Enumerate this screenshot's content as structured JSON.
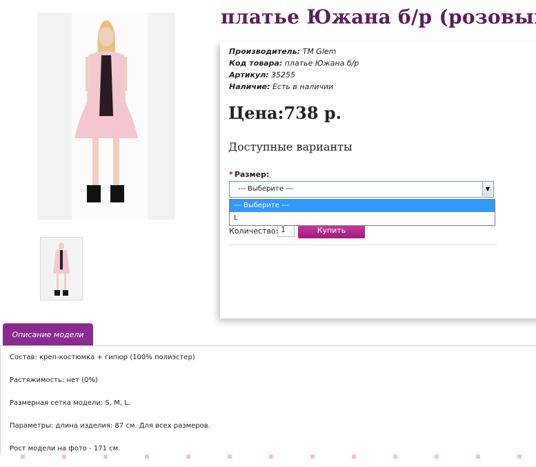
{
  "product": {
    "title": "платье Южана б/р (розовый)",
    "meta": [
      {
        "label": "Производитель:",
        "value": "TM Glem"
      },
      {
        "label": "Код товара:",
        "value": "платье Южана б/р"
      },
      {
        "label": "Артикул:",
        "value": "35255"
      },
      {
        "label": "Наличие:",
        "value": "Есть в наличии"
      }
    ],
    "price": "Цена:738 р.",
    "variants_heading": "Доступные варианты",
    "size_label": "Размер:",
    "size_required_mark": "*",
    "size_select_value": "--- Выберите ---",
    "size_options": [
      "--- Выберите ---",
      "L"
    ],
    "quantity_label": "Количество:",
    "quantity_value": "1",
    "buy_label": "Купить"
  },
  "tabs": {
    "description": "Описание модели"
  },
  "description": [
    {
      "label": "Состав:",
      "value": " креп-костюмка + гипюр (100% полиэстер)"
    },
    {
      "label": "Растяжимость:",
      "value": " нет (0%)"
    },
    {
      "label": "Размерная сетка модели:",
      "value": " S, M, L."
    },
    {
      "label": "Параметры:",
      "value": " длина изделия: 87 см. Для всех размеров."
    },
    {
      "label": "Рост модели на фото",
      "value": " - 171 см."
    }
  ],
  "colors": {
    "accent": "#8b2a91",
    "title": "#5b1d5b",
    "buy": "#c02b97",
    "dress": "#f4c6cf"
  }
}
